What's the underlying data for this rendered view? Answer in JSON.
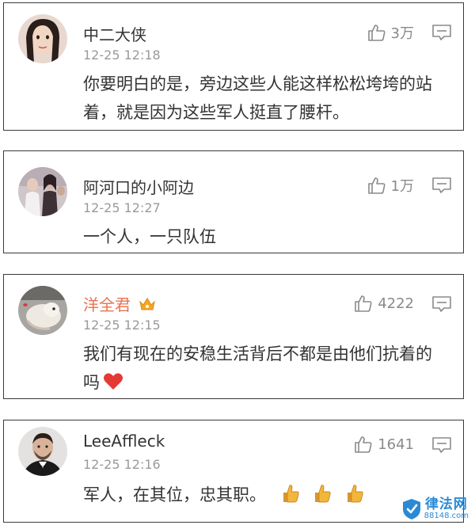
{
  "comments": [
    {
      "username": "中二大侠",
      "time": "12-25 12:18",
      "content": "你要明白的是，旁边这些人能这样松松垮垮的站着，就是因为这些军人挺直了腰杆。",
      "likes": "3万",
      "avatar_icon": "avatar-photo-icon"
    },
    {
      "username": "阿河口的小阿边",
      "time": "12-25 12:27",
      "content": "一个人，一只队伍",
      "likes": "1万",
      "avatar_icon": "avatar-photo-icon"
    },
    {
      "username": "洋全君",
      "time": "12-25 12:15",
      "content": "我们有现在的安稳生活背后不都是由他们抗着的吗",
      "likes": "4222",
      "vip_badge": "crown-badge-icon",
      "emoji": "red-heart-icon",
      "name_color": "#eb7350",
      "avatar_icon": "avatar-photo-icon"
    },
    {
      "username": "LeeAffleck",
      "time": "12-25 12:16",
      "content": "军人，在其位，忠其职。",
      "likes": "1641",
      "emoji": "thumbs-up-emoji-icon",
      "avatar_icon": "avatar-photo-icon"
    }
  ],
  "icons": {
    "like": "thumbs-up-outline-icon",
    "reply": "comment-bubble-icon"
  },
  "watermark": {
    "title": "律法网",
    "subtitle": "88148.com"
  }
}
